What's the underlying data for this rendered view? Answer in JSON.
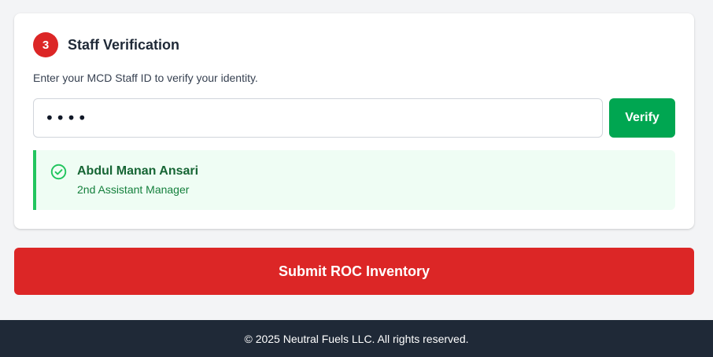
{
  "verification": {
    "step_number": "3",
    "title": "Staff Verification",
    "instructions": "Enter your MCD Staff ID to verify your identity.",
    "staff_id_value": "1234",
    "verify_label": "Verify",
    "result": {
      "status": "verified",
      "icon": "check-circle-icon",
      "name": "Abdul Manan Ansari",
      "role": "2nd Assistant Manager"
    }
  },
  "submit_label": "Submit ROC Inventory",
  "footer": {
    "text": "© 2025 Neutral Fuels LLC. All rights reserved."
  },
  "colors": {
    "accent_red": "#dc2626",
    "verify_green": "#00a651",
    "success_bg": "#effdf4",
    "success_border": "#22c55e",
    "footer_bg": "#1f2937"
  }
}
